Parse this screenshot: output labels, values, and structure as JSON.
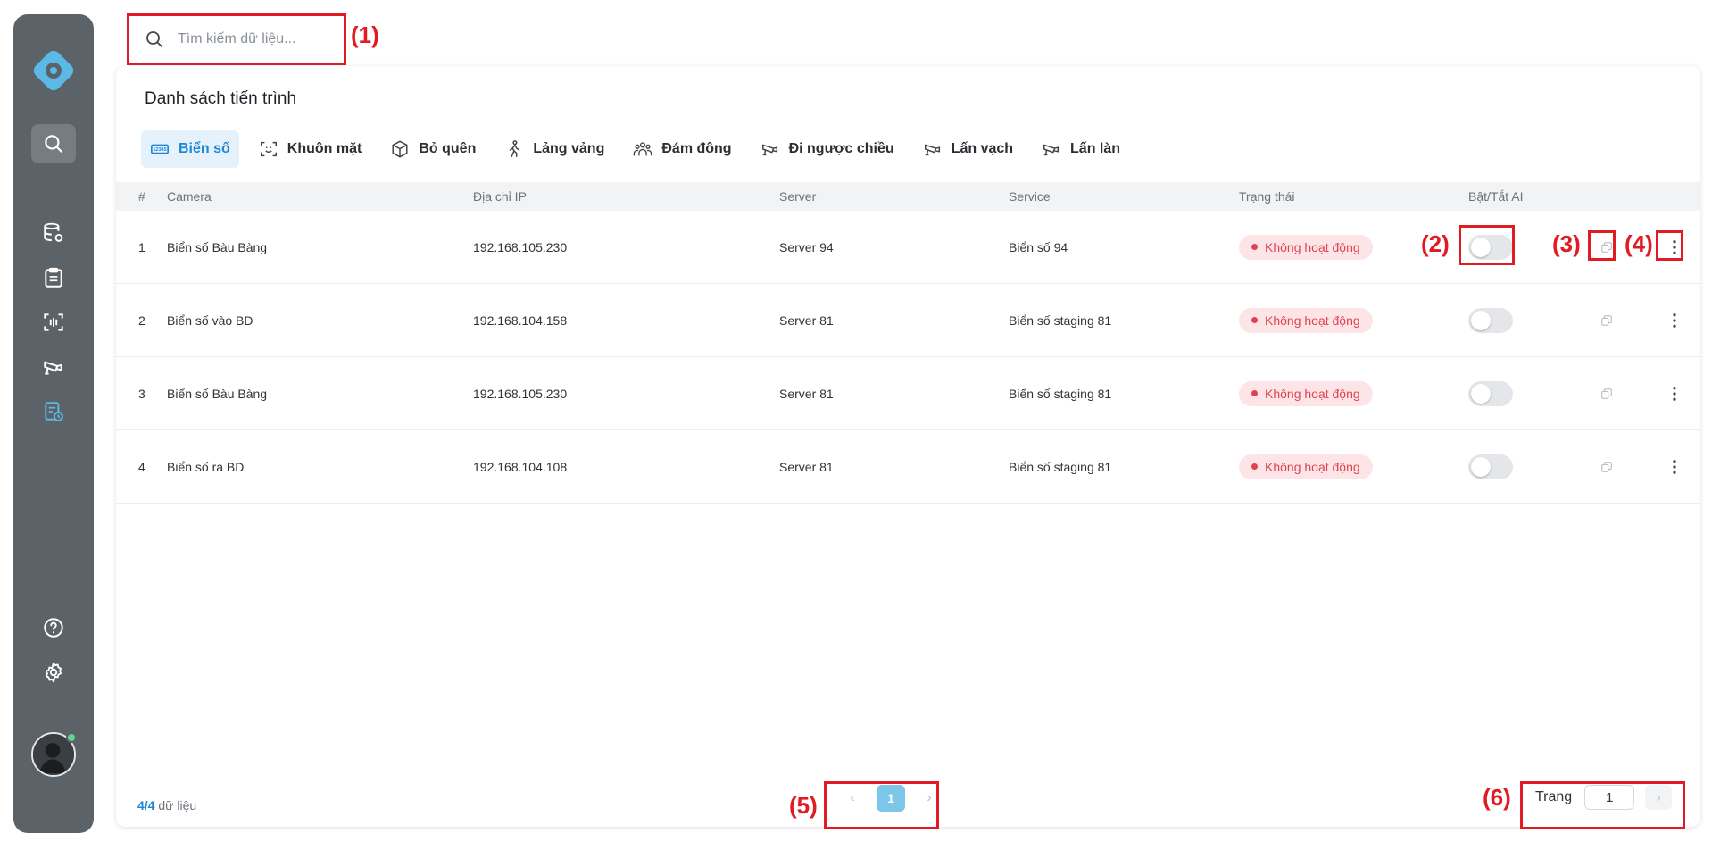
{
  "search": {
    "placeholder": "Tìm kiếm dữ liệu..."
  },
  "page": {
    "title": "Danh sách tiến trình"
  },
  "tabs": [
    {
      "label": "Biển số",
      "icon": "license-plate-icon",
      "active": true
    },
    {
      "label": "Khuôn mặt",
      "icon": "face-scan-icon"
    },
    {
      "label": "Bỏ quên",
      "icon": "box-icon"
    },
    {
      "label": "Lảng vảng",
      "icon": "walking-person-icon"
    },
    {
      "label": "Đám đông",
      "icon": "crowd-icon"
    },
    {
      "label": "Đi ngược chiều",
      "icon": "cctv-camera-icon"
    },
    {
      "label": "Lấn vạch",
      "icon": "cctv-camera-icon"
    },
    {
      "label": "Lấn làn",
      "icon": "cctv-camera-icon"
    }
  ],
  "table": {
    "columns": {
      "idx": "#",
      "camera": "Camera",
      "ip": "Địa chỉ IP",
      "server": "Server",
      "service": "Service",
      "status": "Trạng thái",
      "ai": "Bật/Tắt AI"
    },
    "rows": [
      {
        "idx": "1",
        "camera": "Biển số Bàu Bàng",
        "ip": "192.168.105.230",
        "server": "Server 94",
        "service": "Biển số 94",
        "status": "Không hoạt động",
        "ai_on": false
      },
      {
        "idx": "2",
        "camera": "Biển số vào BD",
        "ip": "192.168.104.158",
        "server": "Server 81",
        "service": "Biển số staging 81",
        "status": "Không hoạt động",
        "ai_on": false
      },
      {
        "idx": "3",
        "camera": "Biển số Bàu Bàng",
        "ip": "192.168.105.230",
        "server": "Server 81",
        "service": "Biển số staging 81",
        "status": "Không hoạt động",
        "ai_on": false
      },
      {
        "idx": "4",
        "camera": "Biển số ra BD",
        "ip": "192.168.104.108",
        "server": "Server 81",
        "service": "Biển số staging 81",
        "status": "Không hoạt động",
        "ai_on": false
      }
    ]
  },
  "footer": {
    "count_shown": "4",
    "count_total": "/4",
    "count_suffix": " dữ liệu",
    "current_page": "1",
    "goto_label": "Trang",
    "goto_value": "1"
  },
  "annotations": [
    "(1)",
    "(2)",
    "(3)",
    "(4)",
    "(5)",
    "(6)"
  ],
  "colors": {
    "accent": "#1e88d6",
    "sidebar": "#5b6268",
    "status_bg": "#fde5e7",
    "status_text": "#e0424f",
    "annotation": "#e11b22"
  }
}
